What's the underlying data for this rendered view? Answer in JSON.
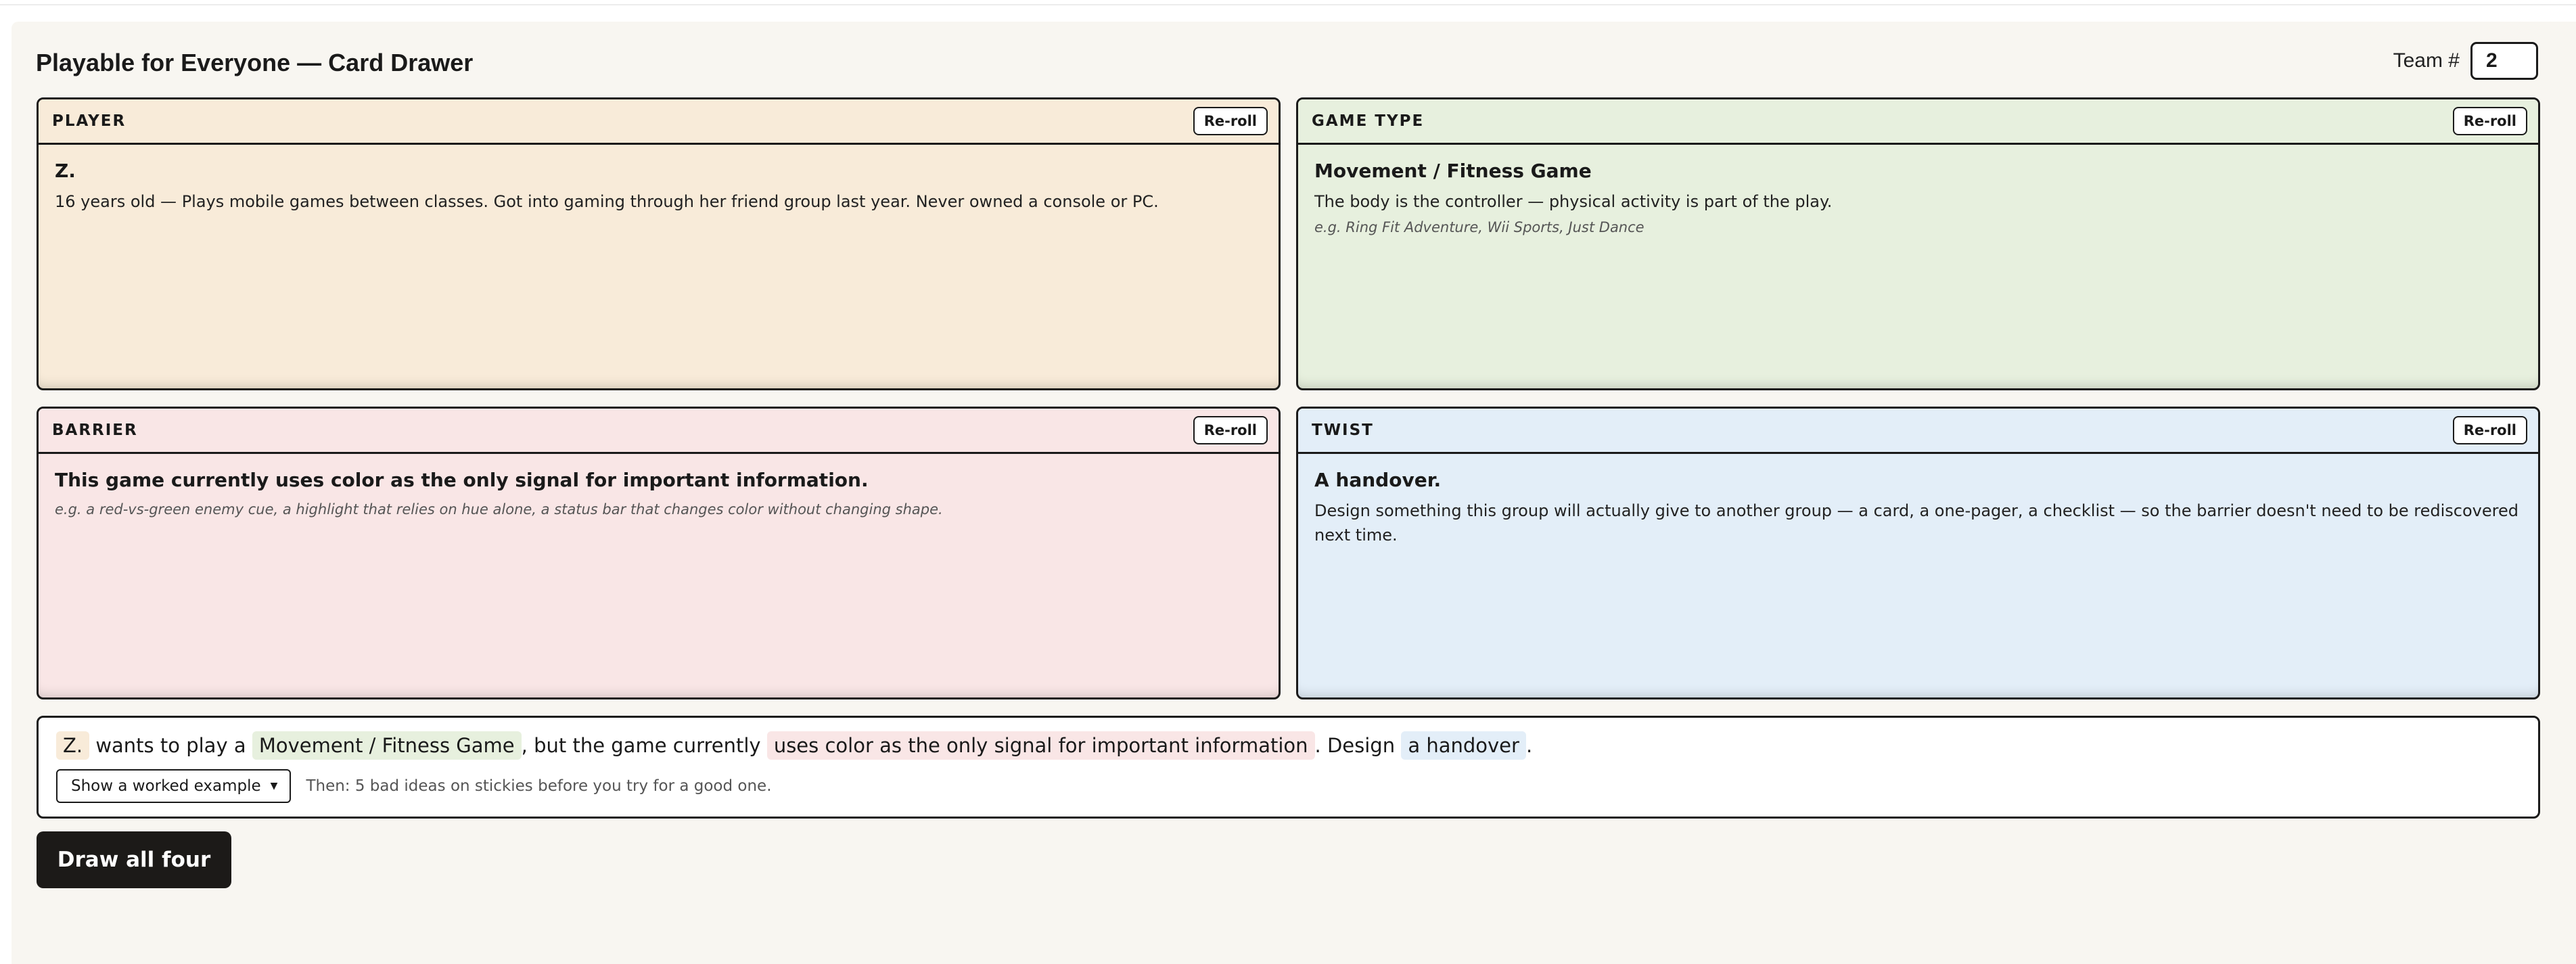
{
  "app": {
    "title": "Playable for Everyone — Card Drawer"
  },
  "team": {
    "label": "Team #",
    "value": "2"
  },
  "cards": {
    "player": {
      "label": "PLAYER",
      "reroll_label": "Re-roll",
      "title": "Z.",
      "description": "16 years old — Plays mobile games between classes. Got into gaming through her friend group last year. Never owned a console or PC."
    },
    "game_type": {
      "label": "GAME TYPE",
      "reroll_label": "Re-roll",
      "title": "Movement / Fitness Game",
      "description": "The body is the controller — physical activity is part of the play.",
      "example": "e.g. Ring Fit Adventure, Wii Sports, Just Dance"
    },
    "barrier": {
      "label": "BARRIER",
      "reroll_label": "Re-roll",
      "title": "This game currently uses color as the only signal for important information.",
      "example": "e.g. a red-vs-green enemy cue, a highlight that relies on hue alone, a status bar that changes color without changing shape."
    },
    "twist": {
      "label": "TWIST",
      "reroll_label": "Re-roll",
      "title": "A handover.",
      "description": "Design something this group will actually give to another group — a card, a one-pager, a checklist — so the barrier doesn't need to be rediscovered next time."
    }
  },
  "prompt": {
    "player_chip": "Z.",
    "text_1": "wants to play a",
    "game_chip": "Movement / Fitness Game",
    "text_2": ", but the game currently",
    "barrier_chip": "uses color as the only signal for important information",
    "text_3": ". Design",
    "twist_chip": "a handover",
    "text_4": "."
  },
  "example_select": {
    "label": "Show a worked example"
  },
  "hint": "Then: 5 bad ideas on stickies before you try for a good one.",
  "draw_button": "Draw all four",
  "colors": {
    "player": "#f8ebd9",
    "game_type": "#e7f0de",
    "barrier": "#f9e6e6",
    "twist": "#e3eef8",
    "page_bg": "#f8f6f1",
    "button_dark": "#1c1a18"
  }
}
